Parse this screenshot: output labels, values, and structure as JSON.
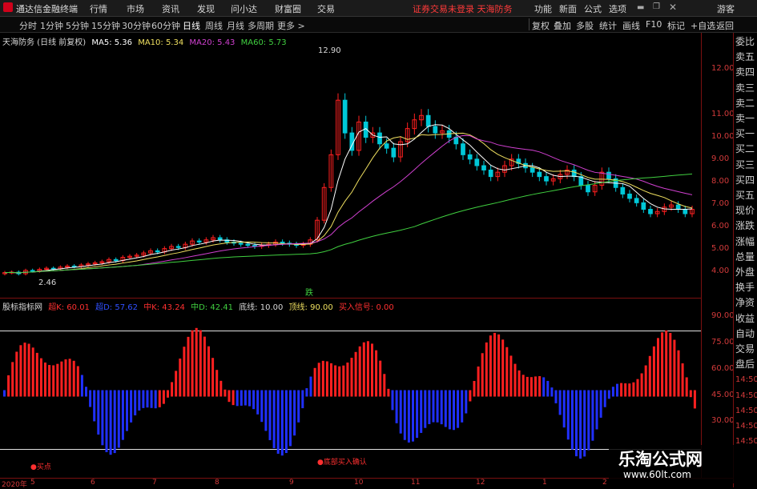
{
  "app": {
    "title": "通达信金融终端"
  },
  "menu": [
    "行情",
    "市场",
    "资讯",
    "发现",
    "问小达",
    "财富圈",
    "交易"
  ],
  "alert": "证券交易未登录 天海防务",
  "menu_right": [
    "功能",
    "新面",
    "公式",
    "选项"
  ],
  "guest": "游客",
  "periods": [
    "分时",
    "1分钟",
    "5分钟",
    "15分钟",
    "30分钟",
    "60分钟",
    "日线",
    "周线",
    "月线",
    "多周期",
    "更多 >"
  ],
  "tools": [
    "复权",
    "叠加",
    "多股",
    "统计",
    "画线",
    "F10",
    "标记",
    "+自选",
    "返回"
  ],
  "main_legend": {
    "name": "天海防务 (日线 前复权)",
    "ma5": "MA5: 5.36",
    "ma10": "MA10: 5.34",
    "ma20": "MA20: 5.43",
    "ma60": "MA60: 5.73"
  },
  "annotations": {
    "high": "12.90",
    "low": "2.46",
    "signal": "跌"
  },
  "indicator_legend": {
    "name": "股标指标网",
    "k": "超K: 60.01",
    "d": "超D: 57.62",
    "mk": "中K: 43.24",
    "md": "中D: 42.41",
    "bottom": "底线: 10.00",
    "top": "顶线: 90.00",
    "buy": "买入信号: 0.00"
  },
  "ind_labels": {
    "buy_point": "●买点",
    "bottom_buy": "●底部买入确认"
  },
  "price_ticks": [
    "12.00",
    "11.00",
    "10.00",
    "9.00",
    "8.00",
    "7.00",
    "6.00",
    "5.00",
    "4.00"
  ],
  "ind_ticks": [
    "90.00",
    "75.00",
    "60.00",
    "45.00",
    "30.00"
  ],
  "side_panel": [
    "委比",
    "卖五",
    "卖四",
    "卖三",
    "卖二",
    "卖一",
    "买一",
    "买二",
    "买三",
    "买四",
    "买五",
    "现价",
    "涨跌",
    "涨幅",
    "总量",
    "外盘",
    "换手",
    "净资",
    "收益",
    "自动",
    "交易",
    "盘后",
    "14:50",
    "14:50",
    "14:50",
    "14:50",
    "14:50"
  ],
  "dates": [
    "2020年",
    "5",
    "6",
    "7",
    "8",
    "9",
    "10",
    "11",
    "12",
    "1",
    "2"
  ],
  "watermark": {
    "title": "乐淘公式网",
    "url": "www.60lt.com"
  },
  "colors": {
    "up": "#ff2020",
    "down": "#00c8d8",
    "ma5": "#ffffff",
    "ma10": "#f0e060",
    "ma20": "#d040d0",
    "ma60": "#40d040",
    "k_up": "#f0e060",
    "blue": "#2030ff",
    "red": "#ff2020"
  },
  "chart_data": {
    "type": "candlestick",
    "ylim": [
      2,
      13
    ],
    "close": [
      2.6,
      2.62,
      2.55,
      2.7,
      2.68,
      2.75,
      2.8,
      2.78,
      2.85,
      2.9,
      2.88,
      2.95,
      3.0,
      3.05,
      3.1,
      3.2,
      3.15,
      3.3,
      3.35,
      3.4,
      3.5,
      3.6,
      3.55,
      3.7,
      3.8,
      3.75,
      3.9,
      4.05,
      4.0,
      4.1,
      4.2,
      4.1,
      4.0,
      3.95,
      3.9,
      3.85,
      3.8,
      3.85,
      3.9,
      4.0,
      3.95,
      3.9,
      3.85,
      3.9,
      4.1,
      5.0,
      6.5,
      8.0,
      10.5,
      9.0,
      8.2,
      9.5,
      8.8,
      9.0,
      8.5,
      8.3,
      7.9,
      8.6,
      9.2,
      9.6,
      9.8,
      9.3,
      9.0,
      9.1,
      8.8,
      8.5,
      8.0,
      7.8,
      7.5,
      7.3,
      7.0,
      7.2,
      7.5,
      7.8,
      7.6,
      7.4,
      7.2,
      7.0,
      6.8,
      6.9,
      7.1,
      7.3,
      7.0,
      6.6,
      6.3,
      6.6,
      7.2,
      6.9,
      6.5,
      6.2,
      6.0,
      5.8,
      5.5,
      5.3,
      5.4,
      5.6,
      5.7,
      5.5,
      5.3,
      5.5
    ]
  }
}
